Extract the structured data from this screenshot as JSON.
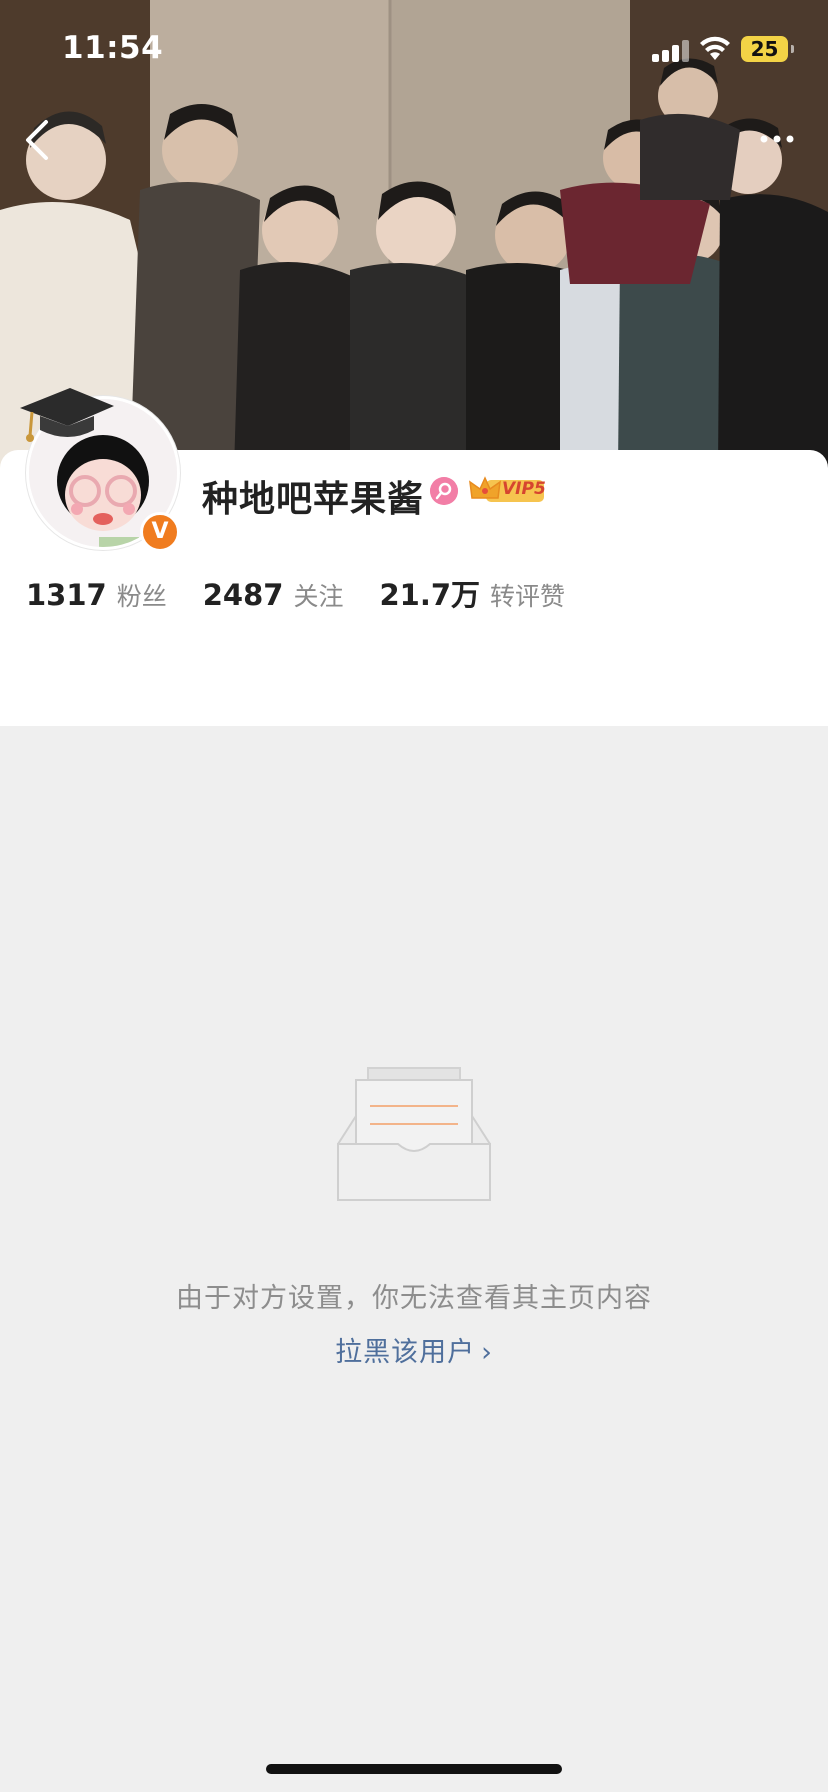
{
  "status_bar": {
    "time": "11:54",
    "battery": "25"
  },
  "profile": {
    "name": "种地吧苹果酱",
    "vip": "VIP5",
    "verified_mark": "V",
    "stats": [
      {
        "value": "1317",
        "label": "粉丝"
      },
      {
        "value": "2487",
        "label": "关注"
      },
      {
        "value": "21.7万",
        "label": "转评赞"
      }
    ]
  },
  "empty_state": {
    "message": "由于对方设置，你无法查看其主页内容",
    "action_label": "拉黑该用户",
    "action_chevron": "›"
  },
  "icons": {
    "back": "chevron-left-icon",
    "more": "more-horizontal-icon",
    "gender": "female-icon",
    "vip": "crown-icon",
    "empty": "empty-inbox-icon"
  },
  "colors": {
    "accent_link": "#4f6f9c",
    "verified_orange": "#f07c1f",
    "gender_pink": "#f27ea6",
    "vip_gold": "#f4b83a",
    "battery_yellow": "#f3d346"
  }
}
